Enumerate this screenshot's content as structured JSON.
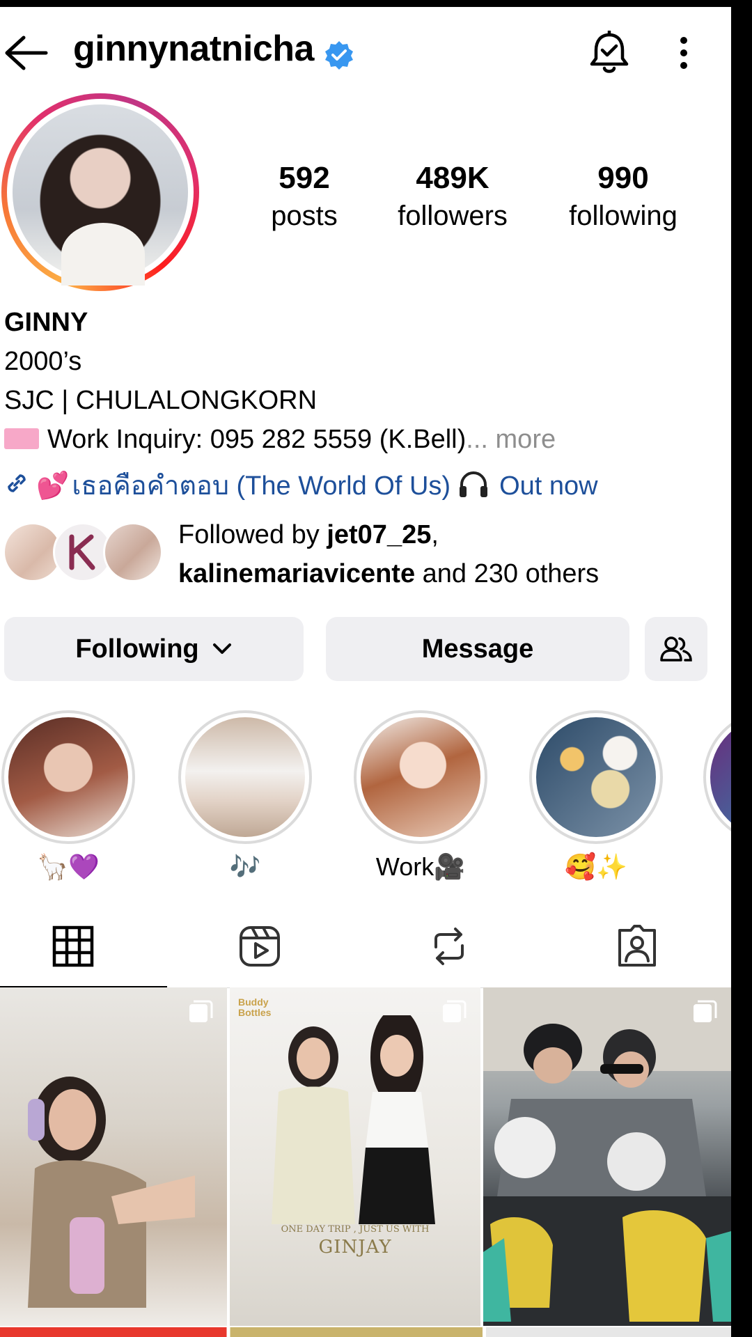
{
  "header": {
    "username": "ginnynatnicha"
  },
  "stats": [
    {
      "num": "592",
      "label": "posts"
    },
    {
      "num": "489K",
      "label": "followers"
    },
    {
      "num": "990",
      "label": "following"
    }
  ],
  "bio": {
    "name": "GINNY",
    "line1": "2000’s",
    "line2": "SJC | CHULALONGKORN",
    "line3": "Work Inquiry: 095 282 5559 (K.Bell)",
    "more": "... more",
    "link_text": "เธอคือคำตอบ (The World Of Us)",
    "link_tail": "Out now"
  },
  "followed_by": {
    "prefix": "Followed by ",
    "user1": "jet07_25",
    "comma": ",",
    "user2": "kalinemariavicente",
    "suffix": " and 230 others"
  },
  "buttons": {
    "following": "Following",
    "message": "Message"
  },
  "highlights": [
    {
      "label": "🦙💜"
    },
    {
      "label": "🎶"
    },
    {
      "label": "Work🎥"
    },
    {
      "label": "🥰✨"
    }
  ],
  "posts": {
    "p2_tag_line1": "Buddy",
    "p2_tag_line2": "Bottles",
    "p2_caption_small": "ONE DAY TRIP , JUST US WITH",
    "p2_caption_big": "GINJAY"
  },
  "colors": {
    "link": "#1d4f9a",
    "verified": "#3897f0",
    "button_bg": "#efeff2",
    "muted": "#8e8e8e"
  }
}
